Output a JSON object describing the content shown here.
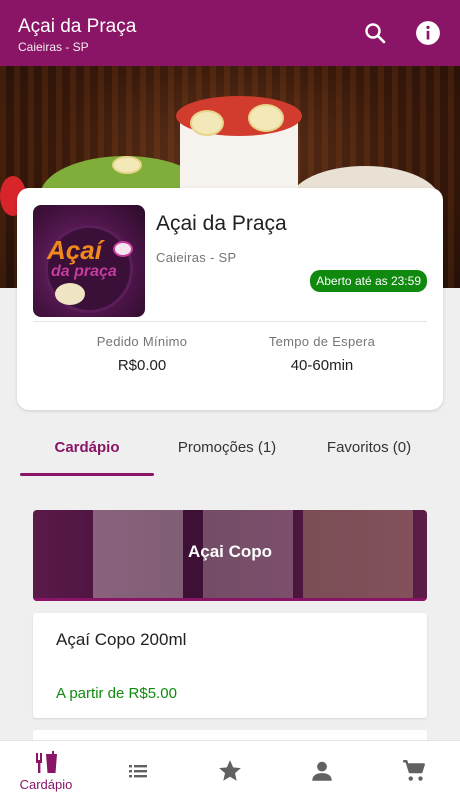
{
  "appbar": {
    "title": "Açai da Praça",
    "subtitle": "Caieiras - SP",
    "icons": [
      "search-icon",
      "info-icon"
    ],
    "color": "#8a1466"
  },
  "store": {
    "name": "Açai da Praça",
    "location": "Caieiras - SP",
    "status": "Aberto até as 23:59",
    "logo_text_1": "Açaí",
    "logo_text_2": "da praça",
    "min_order_label": "Pedido Mínimo",
    "min_order_value": "R$0.00",
    "wait_label": "Tempo de Espera",
    "wait_value": "40-60min"
  },
  "tabs": [
    {
      "label": "Cardápio",
      "active": true
    },
    {
      "label": "Promoções (1)",
      "active": false
    },
    {
      "label": "Favoritos (0)",
      "active": false
    }
  ],
  "category": {
    "title": "Açai Copo"
  },
  "products": [
    {
      "name": "Açaí Copo 200ml",
      "price": "A partir de R$5.00"
    }
  ],
  "bottom_nav": [
    {
      "icon": "cutlery-icon",
      "label": "Cardápio",
      "active": true
    },
    {
      "icon": "list-icon",
      "label": "",
      "active": false
    },
    {
      "icon": "star-icon",
      "label": "",
      "active": false
    },
    {
      "icon": "person-icon",
      "label": "",
      "active": false
    },
    {
      "icon": "cart-icon",
      "label": "",
      "active": false
    }
  ],
  "colors": {
    "primary": "#8a1466",
    "open_badge": "#0f8a0f",
    "price": "#0f8a0f"
  }
}
